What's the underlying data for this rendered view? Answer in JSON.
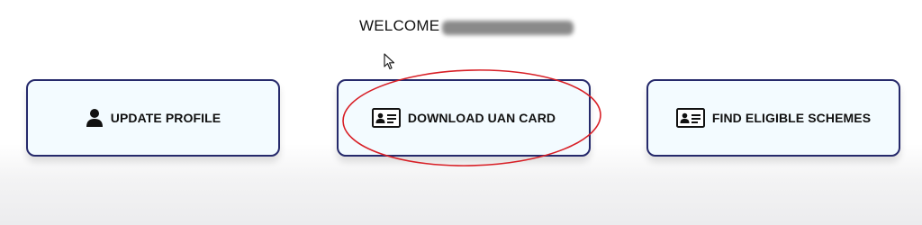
{
  "header": {
    "welcome_label": "WELCOME"
  },
  "cards": [
    {
      "label": "UPDATE PROFILE",
      "icon": "user-icon"
    },
    {
      "label": "DOWNLOAD UAN CARD",
      "icon": "id-card-icon"
    },
    {
      "label": "FIND ELIGIBLE SCHEMES",
      "icon": "id-card-icon"
    }
  ],
  "colors": {
    "card_border": "#25296b",
    "card_background": "#f3fbff",
    "annotation_ellipse": "#d81f26"
  }
}
